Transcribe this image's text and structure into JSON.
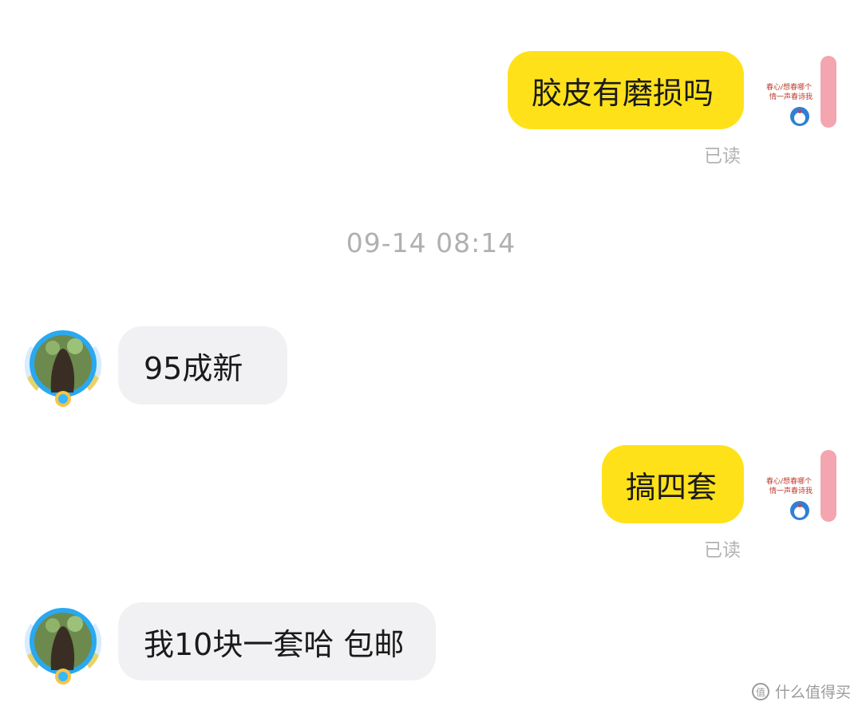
{
  "messages": [
    {
      "direction": "sent",
      "text": "胶皮有磨损吗",
      "status": "已读"
    },
    {
      "direction": "recv",
      "text": "95成新"
    },
    {
      "direction": "sent",
      "text": "搞四套",
      "status": "已读"
    },
    {
      "direction": "recv",
      "text": "我10块一套哈  包邮"
    }
  ],
  "timestamp": "09-14  08:14",
  "watermark": {
    "text": "什么值得买",
    "icon": "zhi-logo-icon"
  },
  "colors": {
    "sent_bubble": "#ffe11a",
    "recv_bubble": "#f1f1f3",
    "read_text": "#b3b3b3"
  }
}
